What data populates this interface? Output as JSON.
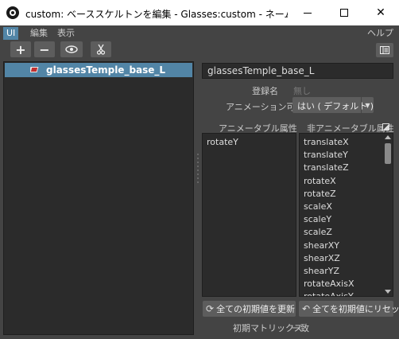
{
  "window": {
    "title": "custom: ベーススケルトンを編集 - Glasses:custom - ネームスペース..."
  },
  "menu": {
    "ui": "UI",
    "edit": "編集",
    "view": "表示",
    "help": "ヘルプ"
  },
  "toolbar": {
    "add_label": "+",
    "remove_label": "−",
    "eye_icon": "eye-icon",
    "cut_icon": "scissors-icon"
  },
  "outliner": {
    "selected_item": "glassesTemple_base_L"
  },
  "properties": {
    "name_value": "glassesTemple_base_L",
    "registered_label": "登録名",
    "registered_value": "無し",
    "animatable_label": "アニメーション可能",
    "animatable_value": "はい ( デフォルト )"
  },
  "attributes": {
    "animatable_header": "アニメータブル属性",
    "non_animatable_header": "非アニメータブル属性",
    "animatable": [
      "rotateY"
    ],
    "non_animatable": [
      "translateX",
      "translateY",
      "translateZ",
      "rotateX",
      "rotateZ",
      "scaleX",
      "scaleY",
      "scaleZ",
      "shearXY",
      "shearXZ",
      "shearYZ",
      "rotateAxisX",
      "rotateAxisY"
    ]
  },
  "actions": {
    "update_all": "全ての初期値を更新",
    "reset_all": "全てを初期値にリセット"
  },
  "status": {
    "matrix_label": "初期マトリックス",
    "matrix_value": "一致"
  },
  "colors": {
    "accent": "#5285a6",
    "panel_bg": "#444444",
    "field_bg": "#2b2b2b",
    "button_bg": "#5d5d5d"
  }
}
